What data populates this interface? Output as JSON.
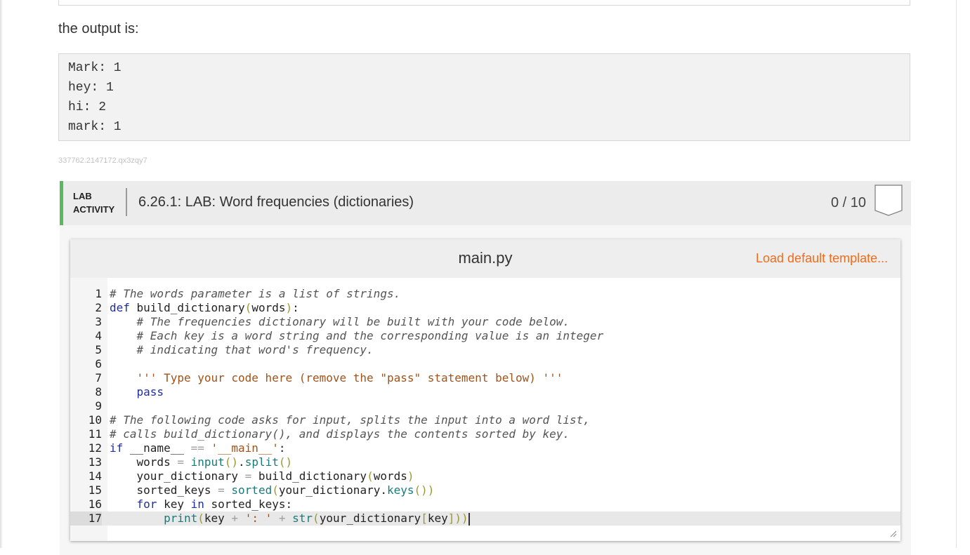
{
  "intro_text": "the output is:",
  "output_lines": [
    "Mark: 1",
    "hey: 1",
    "hi: 2",
    "mark: 1"
  ],
  "identifier": "337762.2147172.qx3zqy7",
  "lab": {
    "badge_line1": "LAB",
    "badge_line2": "ACTIVITY",
    "title": "6.26.1: LAB: Word frequencies (dictionaries)",
    "score": "0 / 10"
  },
  "editor": {
    "file_name": "main.py",
    "load_template_label": "Load default template...",
    "line_numbers": [
      "1",
      "2",
      "3",
      "4",
      "5",
      "6",
      "7",
      "8",
      "9",
      "10",
      "11",
      "12",
      "13",
      "14",
      "15",
      "16",
      "17"
    ],
    "active_line": 17
  },
  "colors": {
    "accent_green": "#5cb85c",
    "link_orange": "#ef6c1c"
  }
}
